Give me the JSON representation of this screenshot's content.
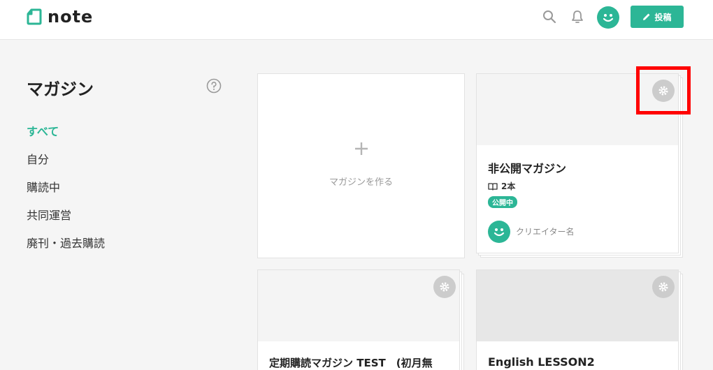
{
  "header": {
    "logo_text": "note",
    "post_label": "投稿"
  },
  "sidebar": {
    "title": "マガジン",
    "items": [
      {
        "label": "すべて",
        "active": true
      },
      {
        "label": "自分",
        "active": false
      },
      {
        "label": "購読中",
        "active": false
      },
      {
        "label": "共同運営",
        "active": false
      },
      {
        "label": "廃刊・過去購読",
        "active": false
      }
    ]
  },
  "create_card": {
    "plus": "+",
    "label": "マガジンを作る"
  },
  "magazines": [
    {
      "title": "非公開マガジン",
      "count": "2本",
      "badge": "公開中",
      "creator": "クリエイター名"
    },
    {
      "title": "定期購読マガジン TEST　(初月無"
    },
    {
      "title": "English LESSON2"
    }
  ],
  "colors": {
    "accent": "#2cb696",
    "highlight": "#ff0000"
  },
  "icons": [
    "note-logo-icon",
    "search-icon",
    "bell-icon",
    "avatar-smile-icon",
    "pencil-icon",
    "help-circle-icon",
    "gear-icon",
    "book-icon"
  ]
}
